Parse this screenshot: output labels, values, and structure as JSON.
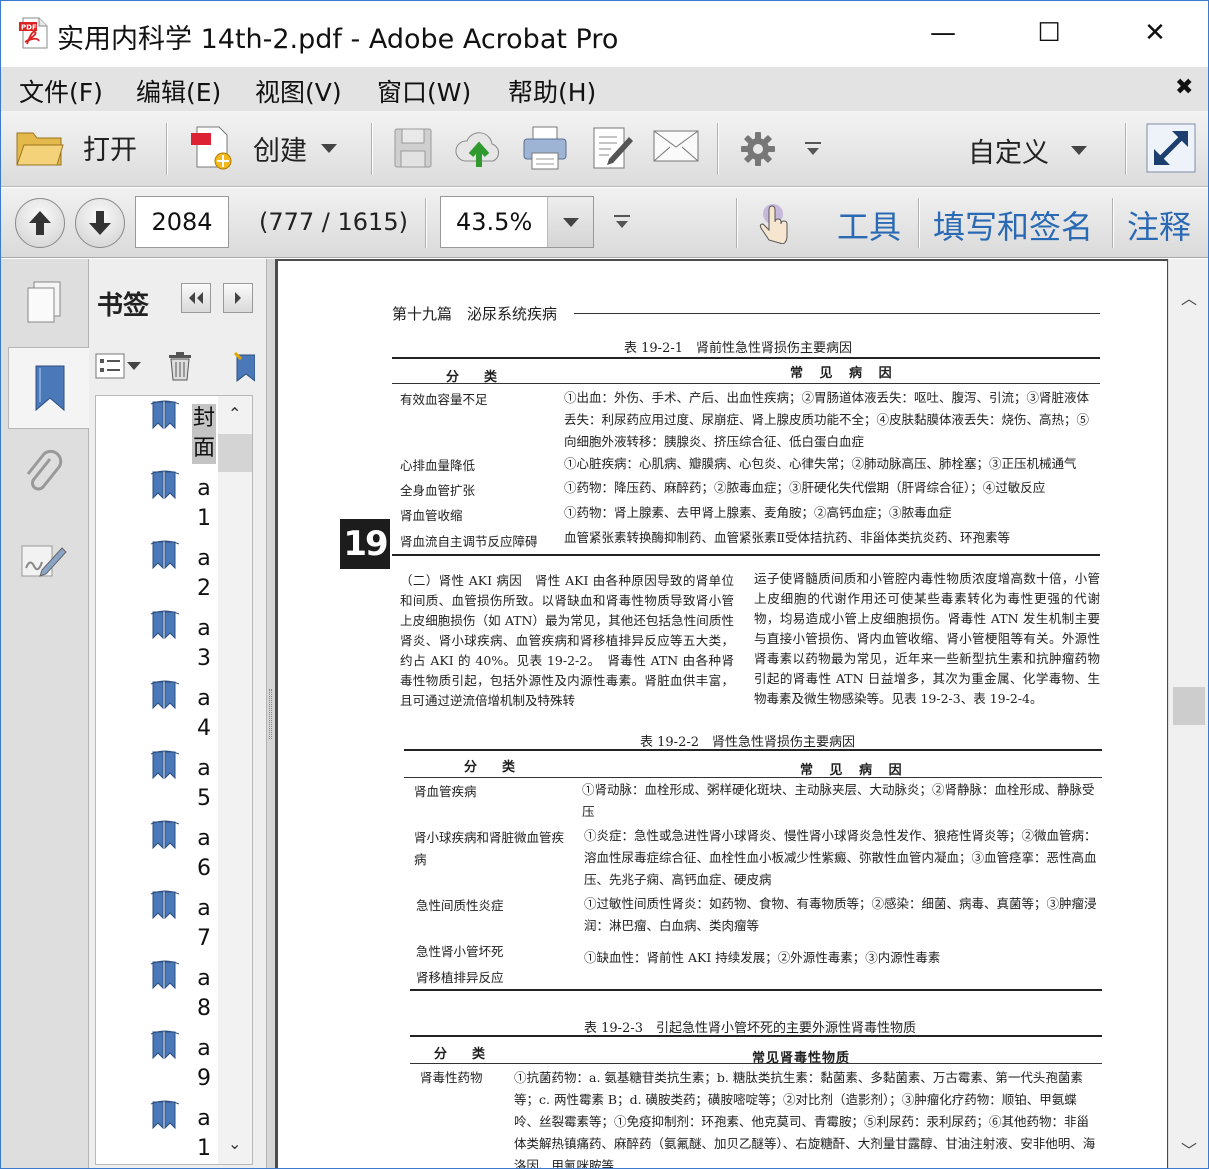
{
  "window": {
    "title": "实用内科学 14th-2.pdf - Adobe Acrobat Pro",
    "minimize": "—",
    "maximize": "☐",
    "close": "✕"
  },
  "menu": {
    "items": [
      "文件(F)",
      "编辑(E)",
      "视图(V)",
      "窗口(W)",
      "帮助(H)"
    ],
    "close_doc": "✖"
  },
  "toolbar": {
    "open_label": "打开",
    "create_label": "创建",
    "customize_label": "自定义"
  },
  "nav": {
    "page_number": "2084",
    "page_count": "(777 / 1615)",
    "zoom": "43.5%",
    "tools_label": "工具",
    "fill_sign_label": "填写和签名",
    "comment_label": "注释"
  },
  "bookmarks": {
    "title": "书签",
    "items": [
      {
        "label": "封面"
      },
      {
        "label": "a1"
      },
      {
        "label": "a2"
      },
      {
        "label": "a3"
      },
      {
        "label": "a4"
      },
      {
        "label": "a5"
      },
      {
        "label": "a6"
      },
      {
        "label": "a7"
      },
      {
        "label": "a8"
      },
      {
        "label": "a9"
      },
      {
        "label": "a1"
      }
    ]
  },
  "document": {
    "chapter_header": "第十九篇　泌尿系统疾病",
    "chapter_tag": "19",
    "table1": {
      "caption": "表 19-2-1　肾前性急性肾损伤主要病因",
      "col1": "分　类",
      "col2": "常 见 病 因",
      "rows": [
        {
          "cat": "有效血容量不足",
          "cause": "①出血：外伤、手术、产后、出血性疾病；②胃肠道体液丢失：呕吐、腹泻、引流；③肾脏液体丢失：利尿药应用过度、尿崩症、肾上腺皮质功能不全；④皮肤黏膜体液丢失：烧伤、高热；⑤向细胞外液转移：胰腺炎、挤压综合征、低白蛋白血症"
        },
        {
          "cat": "心排血量降低",
          "cause": "①心脏疾病：心肌病、瓣膜病、心包炎、心律失常；②肺动脉高压、肺栓塞；③正压机械通气"
        },
        {
          "cat": "全身血管扩张",
          "cause": "①药物：降压药、麻醉药；②脓毒血症；③肝硬化失代偿期（肝肾综合征）；④过敏反应"
        },
        {
          "cat": "肾血管收缩",
          "cause": "①药物：肾上腺素、去甲肾上腺素、麦角胺；②高钙血症；③脓毒血症"
        },
        {
          "cat": "肾血流自主调节反应障碍",
          "cause": "血管紧张素转换酶抑制药、血管紧张素Ⅱ受体拮抗药、非甾体类抗炎药、环孢素等"
        }
      ]
    },
    "para_left": "（二）肾性 AKI 病因　肾性 AKI 由各种原因导致的肾单位和间质、血管损伤所致。以肾缺血和肾毒性物质导致肾小管上皮细胞损伤（如 ATN）最为常见，其他还包括急性间质性肾炎、肾小球疾病、血管疾病和肾移植排异反应等五大类，约占 AKI 的 40%。见表 19-2-2。　肾毒性 ATN 由各种肾毒性物质引起，包括外源性及内源性毒素。肾脏血供丰富，且可通过逆流倍增机制及特殊转",
    "para_right": "运子使肾髓质间质和小管腔内毒性物质浓度增高数十倍，小管上皮细胞的代谢作用还可使某些毒素转化为毒性更强的代谢物，均易造成小管上皮细胞损伤。肾毒性 ATN 发生机制主要与直接小管损伤、肾内血管收缩、肾小管梗阻等有关。外源性肾毒素以药物最为常见，近年来一些新型抗生素和抗肿瘤药物引起的肾毒性 ATN 日益增多，其次为重金属、化学毒物、生物毒素及微生物感染等。见表 19-2-3、表 19-2-4。",
    "table2": {
      "caption": "表 19-2-2　肾性急性肾损伤主要病因",
      "col1": "分　类",
      "col2": "常 见 病 因",
      "rows": [
        {
          "cat": "肾血管疾病",
          "cause": "①肾动脉：血栓形成、粥样硬化斑块、主动脉夹层、大动脉炎；②肾静脉：血栓形成、静脉受压"
        },
        {
          "cat": "肾小球疾病和肾脏微血管疾病",
          "cause": "①炎症：急性或急进性肾小球肾炎、慢性肾小球肾炎急性发作、狼疮性肾炎等；②微血管病：溶血性尿毒症综合征、血栓性血小板减少性紫癜、弥散性血管内凝血；③血管痉挛：恶性高血压、先兆子痫、高钙血症、硬皮病"
        },
        {
          "cat": "急性间质性炎症",
          "cause": "①过敏性间质性肾炎：如药物、食物、有毒物质等；②感染：细菌、病毒、真菌等；③肿瘤浸润：淋巴瘤、白血病、类肉瘤等"
        },
        {
          "cat": "急性肾小管坏死",
          "cause": "①缺血性：肾前性 AKI 持续发展；②外源性毒素；③内源性毒素"
        },
        {
          "cat": "肾移植排异反应",
          "cause": ""
        }
      ]
    },
    "table3": {
      "caption": "表 19-2-3　引起急性肾小管坏死的主要外源性肾毒性物质",
      "col1": "分　类",
      "col2": "常见肾毒性物质",
      "rows": [
        {
          "cat": "肾毒性药物",
          "cause": "①抗菌药物：a. 氨基糖苷类抗生素；b. 糖肽类抗生素：黏菌素、多黏菌素、万古霉素、第一代头孢菌素等；c. 两性霉素 B；d. 磺胺类药；磺胺嘧啶等；②对比剂（造影剂）；③肿瘤化疗药物：顺铂、甲氨蝶呤、丝裂霉素等；①免疫抑制剂：环孢素、他克莫司、青霉胺；⑤利尿药：汞利尿药；⑥其他药物：非甾体类解热镇痛药、麻醉药（氨氟醚、加贝乙醚等）、右旋糖酐、大剂量甘露醇、甘油注射液、安非他明、海洛因、甲氰咪胺等"
        }
      ]
    }
  },
  "colors": {
    "accent_link": "#2a6ab5",
    "menubar": "#e3e3e3",
    "doc_background": "#4c4c4c"
  }
}
